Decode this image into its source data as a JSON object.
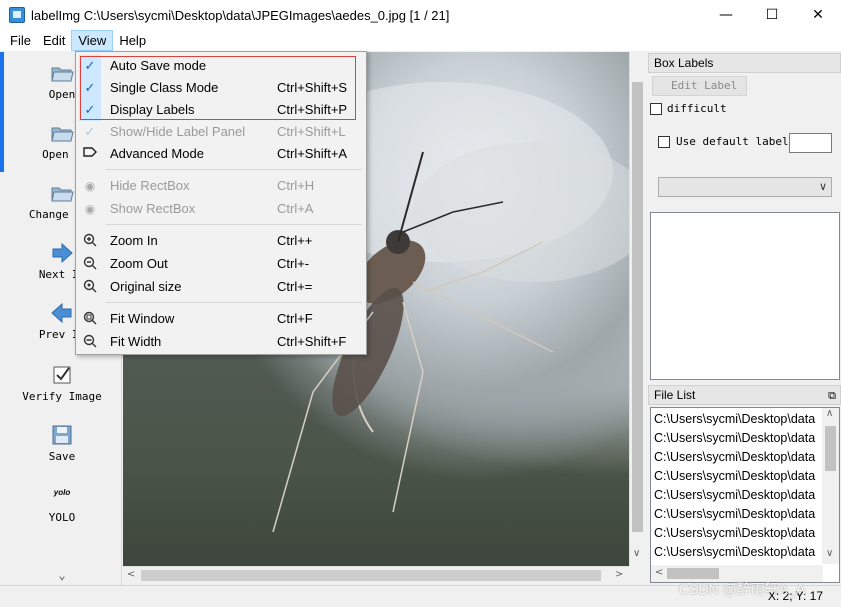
{
  "window": {
    "title": "labelImg C:\\Users\\sycmi\\Desktop\\data\\JPEGImages\\aedes_0.jpg [1 / 21]",
    "minimize": "—",
    "maximize": "☐",
    "close": "✕"
  },
  "menubar": {
    "items": [
      "File",
      "Edit",
      "View",
      "Help"
    ],
    "active": "View"
  },
  "toolbar": {
    "open": "Open",
    "open_dir": "Open D",
    "change_save": "Change Sav",
    "next_image": "Next Im",
    "prev_image": "Prev Im",
    "verify_image": "Verify Image",
    "save": "Save",
    "yolo_icon_text": "yolo",
    "yolo": "YOLO",
    "more": "⌄"
  },
  "view_menu": {
    "items": [
      {
        "label": "Auto Save mode",
        "shortcut": "",
        "checked": true
      },
      {
        "label": "Single Class Mode",
        "shortcut": "Ctrl+Shift+S",
        "checked": true
      },
      {
        "label": "Display Labels",
        "shortcut": "Ctrl+Shift+P",
        "checked": true
      },
      {
        "label": "Show/Hide Label Panel",
        "shortcut": "Ctrl+Shift+L",
        "checked": true,
        "disabled": true
      },
      {
        "label": "Advanced Mode",
        "shortcut": "Ctrl+Shift+A",
        "icon": "tag-icon"
      },
      {
        "label": "Hide RectBox",
        "shortcut": "Ctrl+H",
        "disabled": true,
        "icon": "eye-icon"
      },
      {
        "label": "Show RectBox",
        "shortcut": "Ctrl+A",
        "disabled": true,
        "icon": "eye-icon"
      },
      {
        "label": "Zoom In",
        "shortcut": "Ctrl++",
        "icon": "zoom-in-icon"
      },
      {
        "label": "Zoom Out",
        "shortcut": "Ctrl+-",
        "icon": "zoom-out-icon"
      },
      {
        "label": "Original size",
        "shortcut": "Ctrl+=",
        "icon": "zoom-original-icon"
      },
      {
        "label": "Fit Window",
        "shortcut": "Ctrl+F",
        "icon": "fit-window-icon"
      },
      {
        "label": "Fit Width",
        "shortcut": "Ctrl+Shift+F",
        "icon": "fit-width-icon"
      }
    ]
  },
  "box_labels": {
    "title": "Box Labels",
    "edit_label": "Edit Label",
    "difficult": "difficult",
    "use_default_label": "Use default label",
    "default_label_value": ""
  },
  "file_list": {
    "title": "File List",
    "files": [
      "C:\\Users\\sycmi\\Desktop\\data",
      "C:\\Users\\sycmi\\Desktop\\data",
      "C:\\Users\\sycmi\\Desktop\\data",
      "C:\\Users\\sycmi\\Desktop\\data",
      "C:\\Users\\sycmi\\Desktop\\data",
      "C:\\Users\\sycmi\\Desktop\\data",
      "C:\\Users\\sycmi\\Desktop\\data",
      "C:\\Users\\sycmi\\Desktop\\data"
    ]
  },
  "status": {
    "coords": "X: 2; Y: 17"
  },
  "watermark": "CSDN @醉雨轩A_A",
  "colors": {
    "menu_active_bg": "#cce8ff",
    "check_bg": "#cde8ff",
    "highlight_border": "#e0403a",
    "accent": "#1a73e8"
  }
}
